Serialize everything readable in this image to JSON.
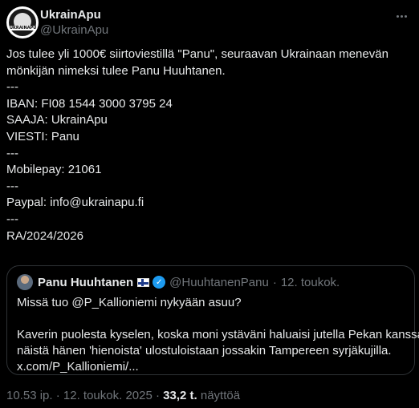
{
  "author": {
    "display_name": "UkrainApu",
    "handle": "@UkrainApu",
    "avatar_text": "UKRAINAPU"
  },
  "tweet": {
    "lines": [
      "Jos tulee yli 1000€ siirtoviestillä \"Panu\", seuraavan Ukrainaan menevän",
      "mönkijän nimeksi tulee Panu Huuhtanen.",
      "---",
      "IBAN: FI08 1544 3000 3795 24",
      "SAAJA: UkrainApu",
      "VIESTI: Panu",
      "---",
      "Mobilepay: 21061",
      "---",
      "Paypal: info@ukrainapu.fi",
      "---",
      "RA/2024/2026"
    ]
  },
  "quote": {
    "display_name": "Panu Huuhtanen",
    "handle": "@HuuhtanenPanu",
    "separator": "·",
    "date": "12. toukok.",
    "lines": [
      "Missä tuo @P_Kallioniemi nykyään asuu?",
      "",
      "Kaverin puolesta kyselen, koska moni ystäväni haluaisi jutella Pekan kanssa",
      "näistä hänen 'hienoista' ulostuloistaan jossakin Tampereen syrjäkujilla.",
      "x.com/P_Kallioniemi/..."
    ]
  },
  "footer": {
    "time": "10.53 ip.",
    "separator1": "·",
    "date": "12. toukok. 2025",
    "separator2": "·",
    "views_count": "33,2 t.",
    "views_label": "näyttöä"
  },
  "colors": {
    "background": "#000000",
    "text": "#e7e9ea",
    "secondary": "#71767b",
    "verified": "#1d9bf0"
  }
}
